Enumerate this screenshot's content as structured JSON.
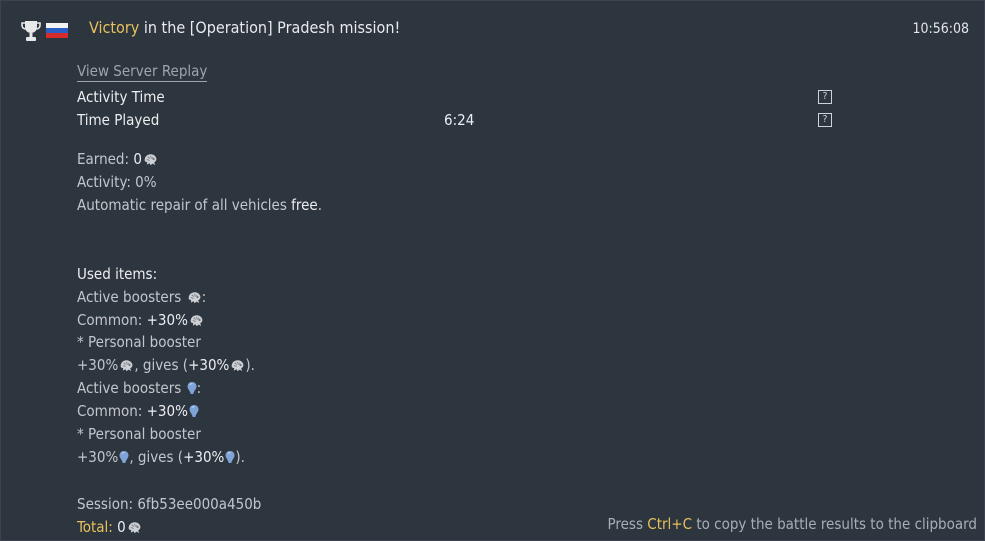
{
  "header": {
    "result_word": "Victory",
    "result_rest": " in the [Operation] Pradesh mission!",
    "time": "10:56:08"
  },
  "links": {
    "replay": "View Server Replay"
  },
  "rows": [
    {
      "label": "Activity Time",
      "value": "",
      "help": "?"
    },
    {
      "label": "Time Played",
      "value": "6:24",
      "help": "?"
    }
  ],
  "summary": {
    "earned_label": "Earned: ",
    "earned_value": "0",
    "activity": "Activity: 0%",
    "repair_label": "Automatic repair of all vehicles ",
    "repair_value": "free",
    "repair_end": "."
  },
  "used_items": {
    "title": "Used items:",
    "lion_boosters": {
      "title": "Active boosters ",
      "colon": ":",
      "common_label": "Common: ",
      "common_value": "+30%",
      "personal": "* Personal booster",
      "pct": "+30%",
      "gives_label": ", gives (",
      "gives_value": "+30%",
      "gives_end": ")."
    },
    "rp_boosters": {
      "title": "Active boosters ",
      "colon": ":",
      "common_label": "Common: ",
      "common_value": "+30%",
      "personal": "* Personal booster",
      "pct": "+30%",
      "gives_label": ", gives (",
      "gives_value": "+30%",
      "gives_end": ")."
    }
  },
  "session": {
    "label": "Session: 6fb53ee000a450b",
    "total_label": "Total:",
    "total_value": " 0"
  },
  "footer": {
    "press": "Press ",
    "keys": "Ctrl+C",
    "rest": " to copy the battle results to the clipboard"
  },
  "icons": {
    "trophy": "trophy-icon",
    "flag": "russia-flag-icon",
    "silver_lion": "silver-lion-icon",
    "research": "research-point-icon",
    "help": "question-icon"
  },
  "colors": {
    "background": "#2d353e",
    "accent_gold": "#e7c15c",
    "text_bright": "#eceef0",
    "text_dim": "#c3c7cc",
    "rp_blue": "#7fa3d6"
  }
}
